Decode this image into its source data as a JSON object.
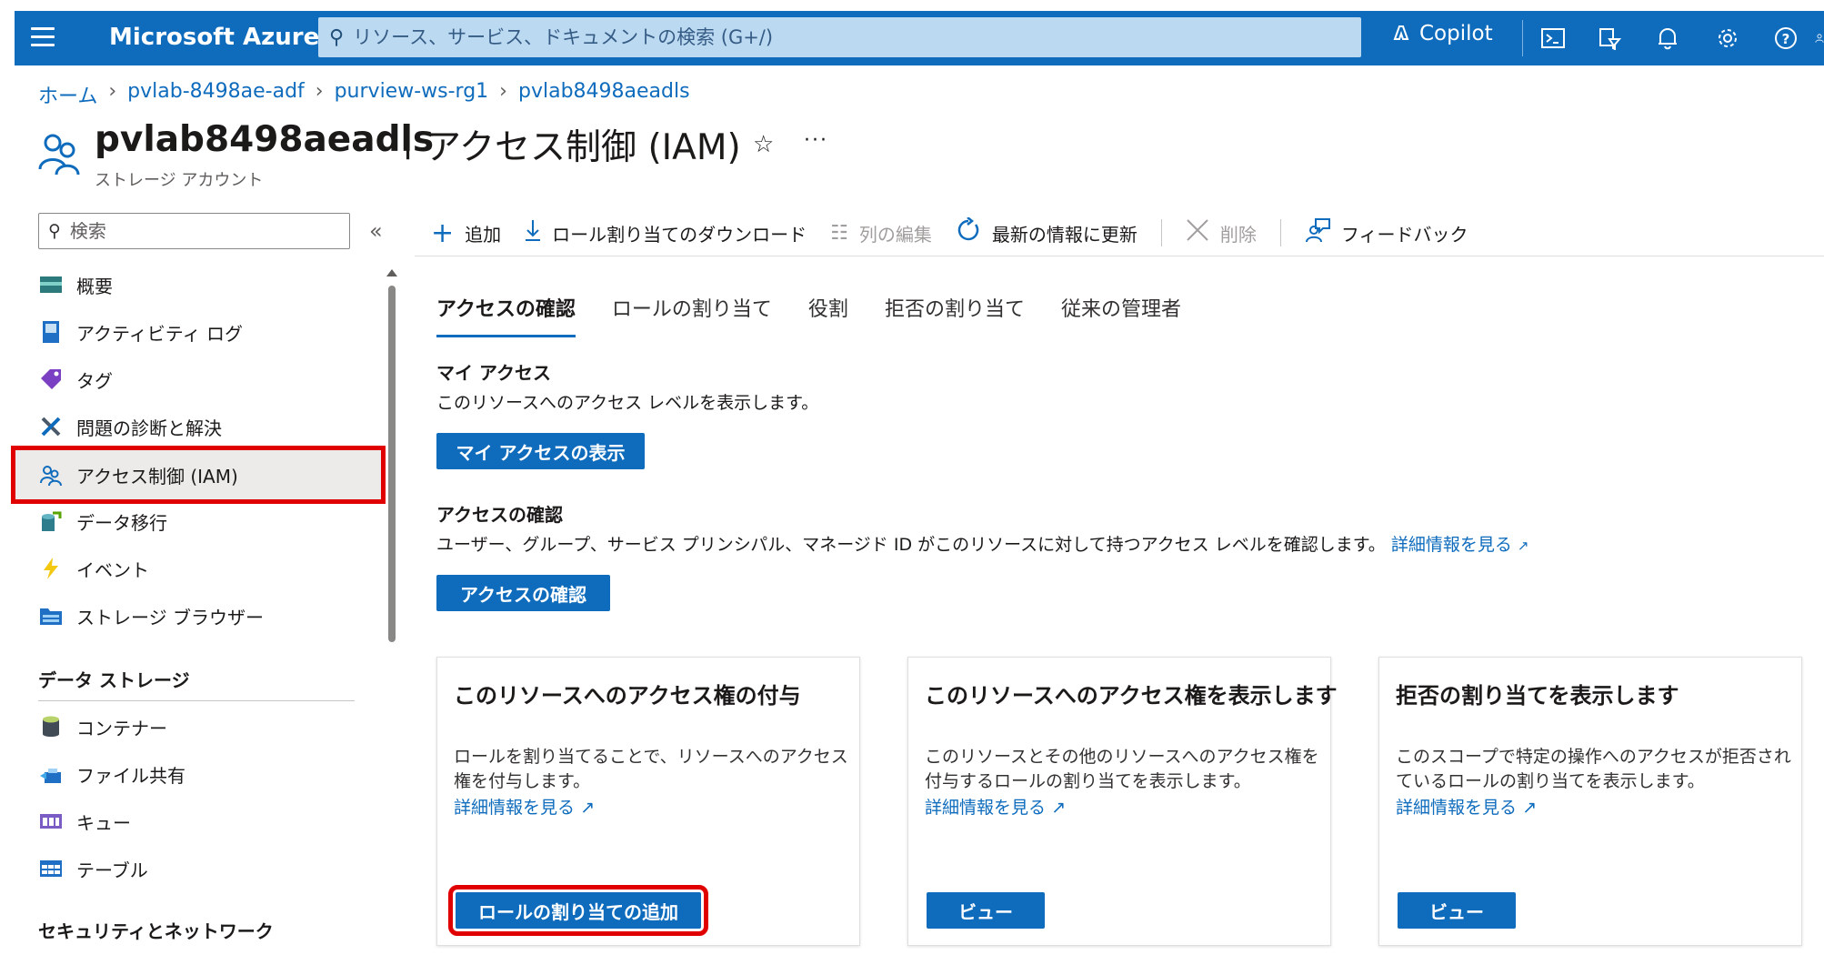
{
  "topbar": {
    "brand": "Microsoft Azure",
    "search_placeholder": "リソース、サービス、ドキュメントの検索 (G+/)",
    "copilot_label": "Copilot",
    "icons": [
      "cloud-shell-icon",
      "directory-filter-icon",
      "notifications-icon",
      "settings-icon",
      "help-icon",
      "account-icon"
    ]
  },
  "breadcrumb": [
    "ホーム",
    "pvlab-8498ae-adf",
    "purview-ws-rg1",
    "pvlab8498aeadls"
  ],
  "header": {
    "resource_name": "pvlab8498aeadls",
    "separator": "|",
    "page_name": "アクセス制御 (IAM)",
    "subtitle": "ストレージ アカウント",
    "star": "☆",
    "more": "···"
  },
  "sidebar": {
    "search_placeholder": "検索",
    "collapse": "«",
    "items": [
      {
        "label": "概要",
        "icon": "overview-icon"
      },
      {
        "label": "アクティビティ ログ",
        "icon": "activity-log-icon"
      },
      {
        "label": "タグ",
        "icon": "tag-icon"
      },
      {
        "label": "問題の診断と解決",
        "icon": "diagnose-icon"
      },
      {
        "label": "アクセス制御 (IAM)",
        "icon": "iam-icon"
      },
      {
        "label": "データ移行",
        "icon": "data-migration-icon"
      },
      {
        "label": "イベント",
        "icon": "events-icon"
      },
      {
        "label": "ストレージ ブラウザー",
        "icon": "storage-browser-icon"
      }
    ],
    "group_data_storage": "データ ストレージ",
    "data_storage_items": [
      {
        "label": "コンテナー",
        "icon": "container-icon"
      },
      {
        "label": "ファイル共有",
        "icon": "file-share-icon"
      },
      {
        "label": "キュー",
        "icon": "queue-icon"
      },
      {
        "label": "テーブル",
        "icon": "table-icon"
      }
    ],
    "group_security": "セキュリティとネットワーク"
  },
  "commands": {
    "add": "追加",
    "download": "ロール割り当てのダウンロード",
    "edit_columns": "列の編集",
    "refresh": "最新の情報に更新",
    "delete": "削除",
    "feedback": "フィードバック"
  },
  "tabs": [
    "アクセスの確認",
    "ロールの割り当て",
    "役割",
    "拒否の割り当て",
    "従来の管理者"
  ],
  "my_access": {
    "title": "マイ アクセス",
    "desc": "このリソースへのアクセス レベルを表示します。",
    "button": "マイ アクセスの表示"
  },
  "check_access": {
    "title": "アクセスの確認",
    "desc": "ユーザー、グループ、サービス プリンシパル、マネージド ID がこのリソースに対して持つアクセス レベルを確認します。",
    "link": "詳細情報を見る",
    "button": "アクセスの確認"
  },
  "cards": [
    {
      "title": "このリソースへのアクセス権の付与",
      "desc": "ロールを割り当てることで、リソースへのアクセス権を付与します。",
      "link": "詳細情報を見る",
      "button": "ロールの割り当ての追加"
    },
    {
      "title": "このリソースへのアクセス権を表示します",
      "desc": "このリソースとその他のリソースへのアクセス権を付与するロールの割り当てを表示します。",
      "link": "詳細情報を見る",
      "button": "ビュー"
    },
    {
      "title": "拒否の割り当てを表示します",
      "desc": "このスコープで特定の操作へのアクセスが拒否されているロールの割り当てを表示します。",
      "link": "詳細情報を見る",
      "button": "ビュー"
    }
  ],
  "colors": {
    "accent": "#0f6cbd",
    "highlight": "#e00000"
  }
}
